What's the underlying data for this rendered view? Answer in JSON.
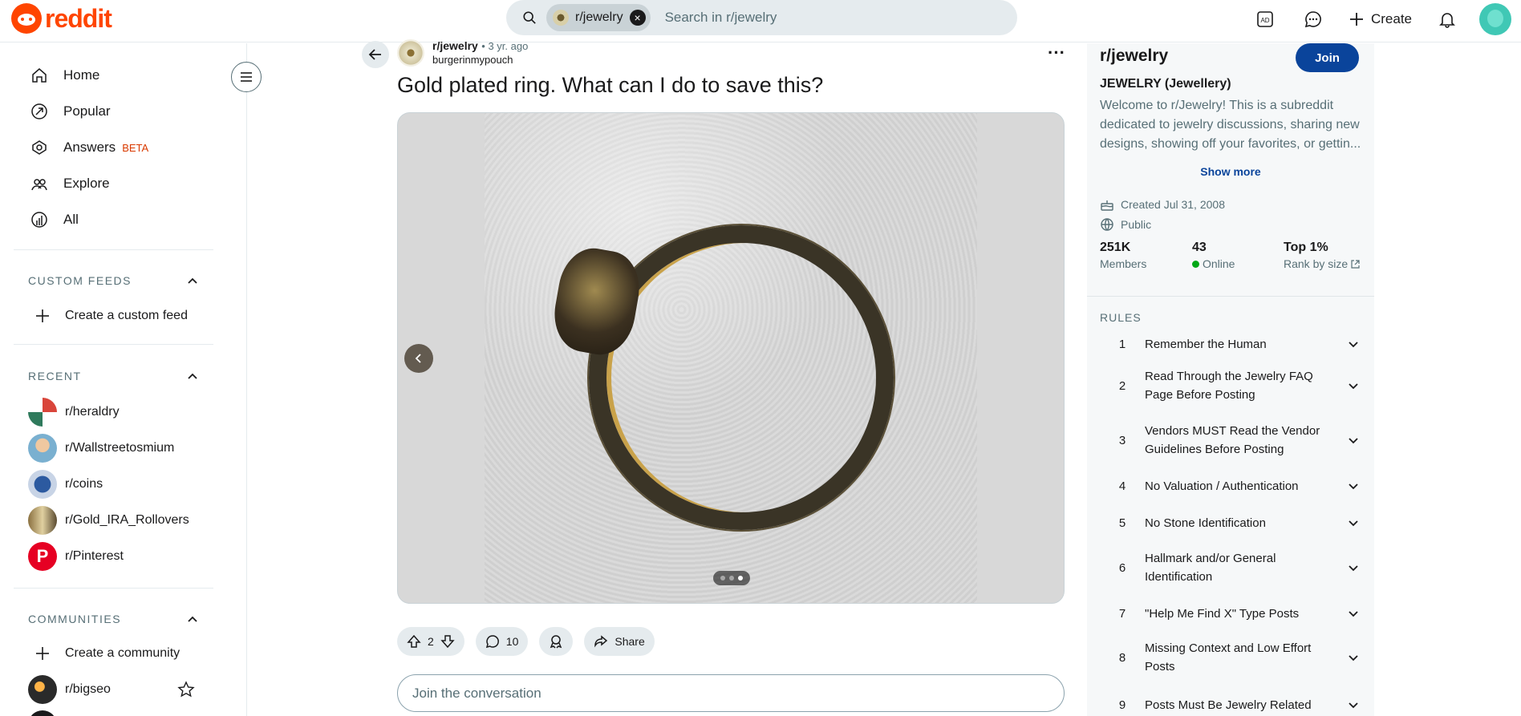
{
  "header": {
    "logo_text": "reddit",
    "search_chip": "r/jewelry",
    "search_placeholder": "Search in r/jewelry",
    "create_label": "Create"
  },
  "sidebar": {
    "nav": [
      {
        "label": "Home",
        "icon": "home-icon"
      },
      {
        "label": "Popular",
        "icon": "popular-icon"
      },
      {
        "label": "Answers",
        "icon": "answers-icon",
        "badge": "BETA"
      },
      {
        "label": "Explore",
        "icon": "explore-icon"
      },
      {
        "label": "All",
        "icon": "all-icon"
      }
    ],
    "custom_feeds": {
      "title": "CUSTOM FEEDS",
      "create_label": "Create a custom feed"
    },
    "recent": {
      "title": "RECENT",
      "items": [
        "r/heraldry",
        "r/Wallstreetosmium",
        "r/coins",
        "r/Gold_IRA_Rollovers",
        "r/Pinterest"
      ]
    },
    "communities": {
      "title": "COMMUNITIES",
      "create_label": "Create a community",
      "items": [
        "r/bigseo"
      ]
    }
  },
  "post": {
    "subreddit": "r/jewelry",
    "time": "• 3 yr. ago",
    "author": "burgerinmypouch",
    "title": "Gold plated ring. What can I do to save this?",
    "gallery": {
      "count": 3,
      "active": 3
    },
    "score": "2",
    "comments": "10",
    "share_label": "Share",
    "comment_placeholder": "Join the conversation"
  },
  "community": {
    "name": "r/jewelry",
    "join_label": "Join",
    "title": "JEWELRY (Jewellery)",
    "description": "Welcome to r/Jewelry! This is a subreddit dedicated to jewelry discussions, sharing new designs, showing off your favorites, or gettin...",
    "show_more": "Show more",
    "created": "Created Jul 31, 2008",
    "visibility": "Public",
    "members_value": "251K",
    "members_label": "Members",
    "online_value": "43",
    "online_label": "Online",
    "rank_value": "Top 1%",
    "rank_label": "Rank by size",
    "rules_title": "RULES",
    "rules": [
      {
        "num": "1",
        "text": "Remember the Human"
      },
      {
        "num": "2",
        "text": "Read Through the Jewelry FAQ Page Before Posting"
      },
      {
        "num": "3",
        "text": "Vendors MUST Read the Vendor Guidelines Before Posting"
      },
      {
        "num": "4",
        "text": "No Valuation / Authentication"
      },
      {
        "num": "5",
        "text": "No Stone Identification"
      },
      {
        "num": "6",
        "text": "Hallmark and/or General Identification"
      },
      {
        "num": "7",
        "text": "\"Help Me Find X\" Type Posts"
      },
      {
        "num": "8",
        "text": "Missing Context and Low Effort Posts"
      },
      {
        "num": "9",
        "text": "Posts Must Be Jewelry Related"
      }
    ]
  },
  "colors": {
    "brand": "#ff4500",
    "join": "#0a449b",
    "online": "#01a816"
  }
}
